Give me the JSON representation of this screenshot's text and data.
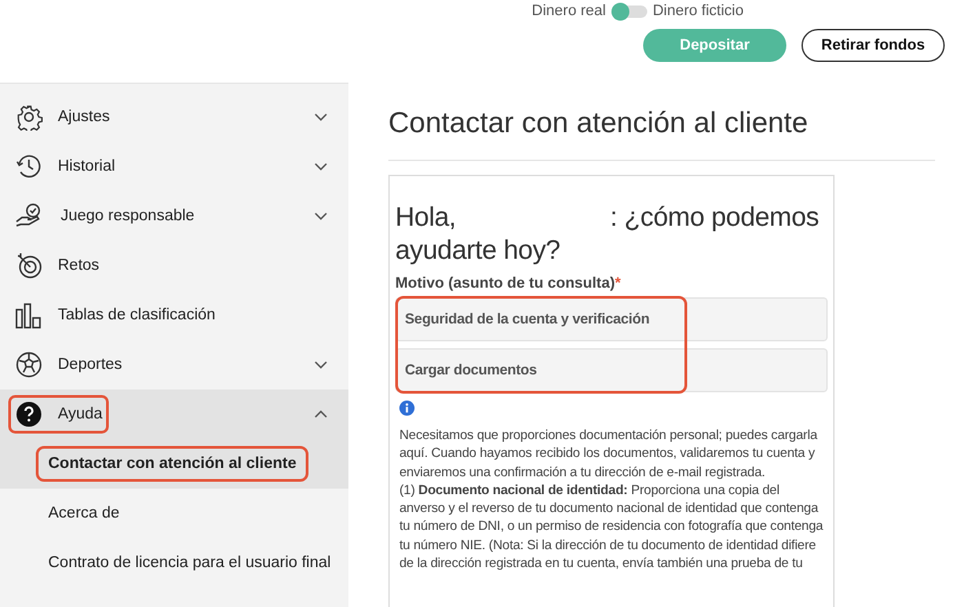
{
  "header": {
    "mode_toggle": {
      "left_label": "Dinero real",
      "right_label": "Dinero ficticio",
      "on": true
    },
    "buttons": [
      {
        "label": "Depositar",
        "kind": "primary"
      },
      {
        "label": "Retirar fondos",
        "kind": "outline"
      }
    ]
  },
  "sidebar": {
    "items": [
      {
        "label": "Ajustes",
        "expanded": false,
        "expandable": true,
        "highlighted": false
      },
      {
        "label": "Historial",
        "expanded": false,
        "expandable": true,
        "highlighted": false
      },
      {
        "label": "Juego responsable",
        "expanded": false,
        "expandable": true,
        "highlighted": false
      },
      {
        "label": "Retos",
        "expandable": false,
        "highlighted": false
      },
      {
        "label": "Tablas de clasificación",
        "expandable": false,
        "highlighted": false
      },
      {
        "label": "Deportes",
        "expanded": false,
        "expandable": true,
        "highlighted": false
      },
      {
        "label": "Ayuda",
        "expanded": true,
        "expandable": true,
        "highlighted": true,
        "children": [
          {
            "label": "Contactar con atención al cliente",
            "selected": true,
            "highlighted": true
          },
          {
            "label": "Acerca de",
            "selected": false,
            "highlighted": false
          },
          {
            "label": "Contrato de licencia para el usuario final",
            "selected": false,
            "highlighted": false
          }
        ]
      }
    ]
  },
  "main": {
    "title": "Contactar con atención al cliente",
    "greeting_start": "Hola,",
    "greeting_end": ": ¿cómo podemos ayudarte hoy?",
    "reason_label": "Motivo (asunto de tu consulta)",
    "required_mark": "*",
    "options": [
      {
        "label": "Seguridad de la cuenta y verificación",
        "highlighted": true
      },
      {
        "label": "Cargar documentos",
        "highlighted": true
      }
    ],
    "info": [
      "Necesitamos que proporciones documentación personal; puedes cargarla aquí. Cuando hayamos recibido los documentos, validaremos tu cuenta y enviaremos una confirmación a tu dirección de e-mail registrada.",
      "(1) **Documento nacional de identidad:** Proporciona una copia del anverso y el reverso de tu documento nacional de identidad que contenga tu número de DNI, o un permiso de residencia con fotografía que contenga tu número NIE. (Nota: Si la dirección de tu documento de identidad difiere de la dirección registrada en tu cuenta, envía también una prueba de tu"
    ]
  }
}
